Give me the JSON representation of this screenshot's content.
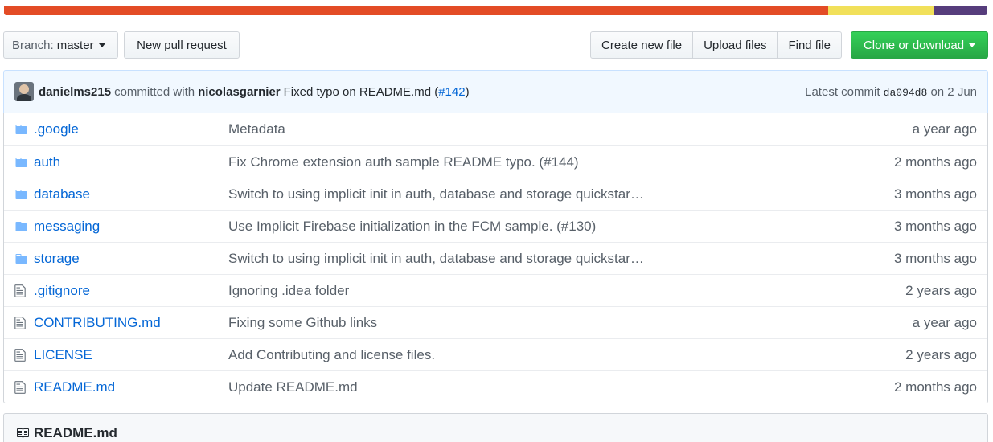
{
  "language_bar": {
    "segments": [
      {
        "color": "#e34c26",
        "percent": 83.8
      },
      {
        "color": "#f1e05a",
        "percent": 10.7
      },
      {
        "color": "#563d7c",
        "percent": 5.5
      }
    ]
  },
  "toolbar": {
    "branch_prefix": "Branch:",
    "branch_name": "master",
    "new_pull_request": "New pull request",
    "create_new_file": "Create new file",
    "upload_files": "Upload files",
    "find_file": "Find file",
    "clone_or_download": "Clone or download"
  },
  "commit": {
    "author": "danielms215",
    "committed_with": "committed with",
    "committer": "nicolasgarnier",
    "message": "Fixed typo on README.md (",
    "issue": "#142",
    "message_end": ")",
    "latest_commit_label": "Latest commit",
    "sha": "da094d8",
    "date": "on 2 Jun"
  },
  "files": [
    {
      "type": "folder",
      "name": ".google",
      "message": "Metadata",
      "age": "a year ago"
    },
    {
      "type": "folder",
      "name": "auth",
      "message": "Fix Chrome extension auth sample README typo. (#144)",
      "age": "2 months ago"
    },
    {
      "type": "folder",
      "name": "database",
      "message": "Switch to using implicit init in auth, database and storage quickstar…",
      "age": "3 months ago"
    },
    {
      "type": "folder",
      "name": "messaging",
      "message": "Use Implicit Firebase initialization in the FCM sample. (#130)",
      "age": "3 months ago"
    },
    {
      "type": "folder",
      "name": "storage",
      "message": "Switch to using implicit init in auth, database and storage quickstar…",
      "age": "3 months ago"
    },
    {
      "type": "file",
      "name": ".gitignore",
      "message": "Ignoring .idea folder",
      "age": "2 years ago"
    },
    {
      "type": "file",
      "name": "CONTRIBUTING.md",
      "message": "Fixing some Github links",
      "age": "a year ago"
    },
    {
      "type": "file",
      "name": "LICENSE",
      "message": "Add Contributing and license files.",
      "age": "2 years ago"
    },
    {
      "type": "file",
      "name": "README.md",
      "message": "Update README.md",
      "age": "2 months ago"
    }
  ],
  "readme": {
    "title": "README.md",
    "icon": "book-icon"
  }
}
